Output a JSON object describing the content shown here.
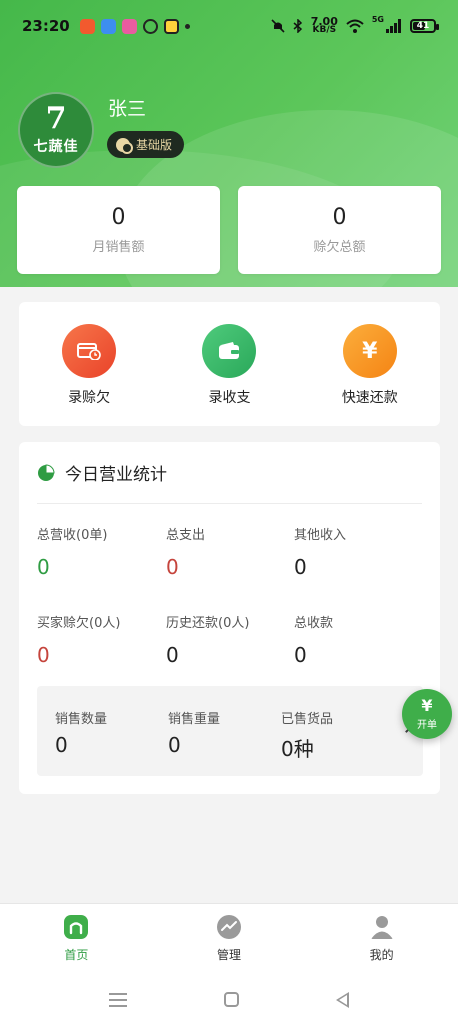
{
  "status_bar": {
    "time": "23:20",
    "net_speed_value": "7.00",
    "net_speed_unit": "KB/S",
    "signal_type": "5G",
    "battery_level": "41",
    "icons": [
      "video-app-icon",
      "cloud-app-icon",
      "shop-app-icon",
      "chat-app-icon",
      "game-app-icon",
      "mute-icon",
      "bluetooth-icon",
      "wifi-icon",
      "signal-icon",
      "battery-icon"
    ]
  },
  "profile": {
    "logo_number": "7",
    "logo_text": "七蔬佳",
    "user_name": "张三",
    "plan": "基础版"
  },
  "summary": {
    "monthly_sales_value": "0",
    "monthly_sales_label": "月销售额",
    "total_debt_value": "0",
    "total_debt_label": "赊欠总额"
  },
  "actions": [
    {
      "label": "录赊欠",
      "color": "#f0582f",
      "icon": "debt-card-icon"
    },
    {
      "label": "录收支",
      "color": "#36b868",
      "icon": "wallet-icon"
    },
    {
      "label": "快速还款",
      "color": "#f7961d",
      "icon": "yen-icon",
      "glyph": "¥"
    }
  ],
  "today_stats": {
    "title": "今日营业统计",
    "items": [
      {
        "label": "总营收(0单)",
        "value": "0",
        "tone": "green"
      },
      {
        "label": "总支出",
        "value": "0",
        "tone": "red"
      },
      {
        "label": "其他收入",
        "value": "0",
        "tone": "normal"
      },
      {
        "label": "买家赊欠(0人)",
        "value": "0",
        "tone": "red"
      },
      {
        "label": "历史还款(0人)",
        "value": "0",
        "tone": "normal"
      },
      {
        "label": "总收款",
        "value": "0",
        "tone": "normal"
      }
    ],
    "sold": [
      {
        "label": "销售数量",
        "value": "0"
      },
      {
        "label": "销售重量",
        "value": "0"
      },
      {
        "label": "已售货品",
        "value": "0种"
      }
    ]
  },
  "fab": {
    "glyph": "¥",
    "label": "开单"
  },
  "bottom_nav": [
    {
      "label": "首页",
      "active": true,
      "icon": "home-icon"
    },
    {
      "label": "管理",
      "active": false,
      "icon": "chart-icon"
    },
    {
      "label": "我的",
      "active": false,
      "icon": "profile-icon"
    }
  ],
  "colors": {
    "brand_green": "#45b84a",
    "positive": "#2f9c43",
    "negative": "#c5443c"
  }
}
